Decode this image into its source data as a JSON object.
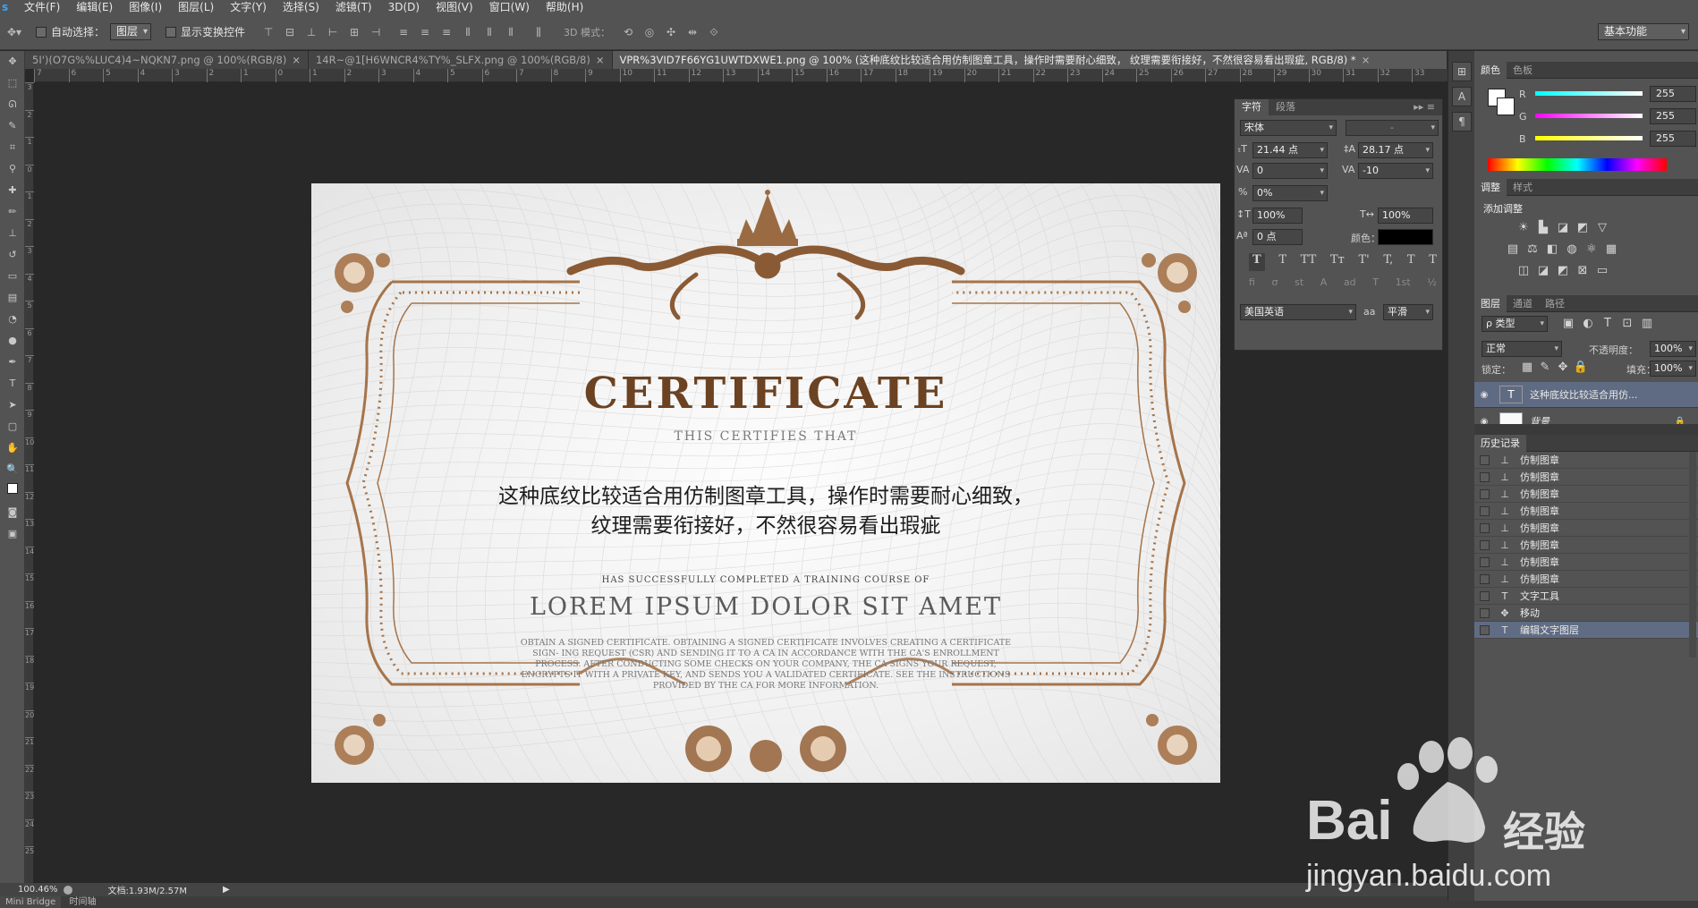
{
  "app": {
    "logo": "s"
  },
  "menu": [
    "文件(F)",
    "编辑(E)",
    "图像(I)",
    "图层(L)",
    "文字(Y)",
    "选择(S)",
    "滤镜(T)",
    "3D(D)",
    "视图(V)",
    "窗口(W)",
    "帮助(H)"
  ],
  "options": {
    "auto_select_label": "自动选择：",
    "auto_select_value": "图层",
    "show_transform_label": "显示变换控件",
    "mode3d_label": "3D 模式：",
    "workspace": "基本功能"
  },
  "tabs": [
    {
      "label": "5I')(O7G%%LUC4)4~NQKN7.png @ 100%(RGB/8)",
      "close": "×",
      "active": false
    },
    {
      "label": "14R~@1[H6WNCR4%TY%_SLFX.png @ 100%(RGB/8)",
      "close": "×",
      "active": false
    },
    {
      "label": "VPR%3VID7F66YG1UWTDXWE1.png @ 100% (这种底纹比较适合用仿制图章工具，操作时需要耐心细致，      纹理需要衔接好，不然很容易看出瑕疵, RGB/8) *",
      "close": "×",
      "active": true
    }
  ],
  "ruler_h": [
    "7",
    "6",
    "5",
    "4",
    "3",
    "2",
    "1",
    "0",
    "1",
    "2",
    "3",
    "4",
    "5",
    "6",
    "7",
    "8",
    "9",
    "10",
    "11",
    "12",
    "13",
    "14",
    "15",
    "16",
    "17",
    "18",
    "19",
    "20",
    "21",
    "22",
    "23",
    "24",
    "25",
    "26",
    "27",
    "28",
    "29",
    "30",
    "31",
    "32",
    "33"
  ],
  "ruler_v": [
    "3",
    "2",
    "1",
    "0",
    "1",
    "2",
    "3",
    "4",
    "5",
    "6",
    "7",
    "8",
    "9",
    "10",
    "11",
    "12",
    "13",
    "14",
    "15",
    "16",
    "17",
    "18",
    "19",
    "20",
    "21",
    "22",
    "23",
    "24",
    "25"
  ],
  "certificate": {
    "title": "CERTIFICATE",
    "subtitle": "THIS  CERTIFIES THAT",
    "cn_line1": "这种底纹比较适合用仿制图章工具，操作时需要耐心细致，",
    "cn_line2": "纹理需要衔接好，不然很容易看出瑕疵",
    "small": "HAS SUCCESSFULLY COMPLETED A TRAINING COURSE OF",
    "lorem": "LOREM IPSUM DOLOR SIT AMET",
    "body": "OBTAIN A SIGNED CERTIFICATE. OBTAINING A SIGNED CERTIFICATE INVOLVES CREATING A CERTIFICATE SIGN- ING REQUEST (CSR) AND SENDING IT TO A CA IN ACCORDANCE WITH THE CA'S ENROLLMENT PROCESS. AFTER CONDUCTING SOME CHECKS ON YOUR COMPANY, THE CA SIGNS YOUR REQUEST, ENCRYPTS IT WITH A PRIVATE KEY, AND SENDS YOU A VALIDATED CERTIFICATE. SEE THE INSTRUCTIONS PROVIDED BY THE CA FOR MORE INFORMATION."
  },
  "status": {
    "zoom": "100.46%",
    "doc": "文档:1.93M/2.57M",
    "play": "▶"
  },
  "bottom_tabs": [
    "Mini Bridge",
    "时间轴"
  ],
  "char_panel": {
    "tab_char": "字符",
    "tab_para": "段落",
    "font": "宋体",
    "style": "-",
    "size": "21.44 点",
    "leading": "28.17 点",
    "kerning": "0",
    "tracking": "-10",
    "scale_pct": "0%",
    "vscale": "100%",
    "hscale": "100%",
    "baseline": "0 点",
    "color_label": "颜色：",
    "styles": [
      "T",
      "T",
      "TT",
      "Tт",
      "T'",
      "T,",
      "T",
      "T"
    ],
    "opentype": [
      "fi",
      "σ",
      "st",
      "A",
      "ad",
      "T",
      "1st",
      "½"
    ],
    "language": "美国英语",
    "aa_icon": "aa",
    "aa": "平滑"
  },
  "color_panel": {
    "tab_color": "颜色",
    "tab_swatch": "色板",
    "r_label": "R",
    "g_label": "G",
    "b_label": "B",
    "r": "255",
    "g": "255",
    "b": "255"
  },
  "adjust_panel": {
    "tab_adjust": "调整",
    "tab_style": "样式",
    "add_label": "添加调整"
  },
  "layers_panel": {
    "tab_layers": "图层",
    "tab_channels": "通道",
    "tab_paths": "路径",
    "filter": "ρ 类型",
    "blend": "正常",
    "opacity_label": "不透明度：",
    "opacity": "100%",
    "lock_label": "锁定：",
    "fill_label": "填充：",
    "fill": "100%",
    "layers": [
      {
        "name": "这种底纹比较适合用仿...",
        "type": "T",
        "selected": true
      },
      {
        "name": "背景",
        "type": "img",
        "selected": false
      }
    ]
  },
  "history_panel": {
    "title": "历史记录",
    "items": [
      {
        "label": "仿制图章",
        "icon": "stamp-icon"
      },
      {
        "label": "仿制图章",
        "icon": "stamp-icon"
      },
      {
        "label": "仿制图章",
        "icon": "stamp-icon"
      },
      {
        "label": "仿制图章",
        "icon": "stamp-icon"
      },
      {
        "label": "仿制图章",
        "icon": "stamp-icon"
      },
      {
        "label": "仿制图章",
        "icon": "stamp-icon"
      },
      {
        "label": "仿制图章",
        "icon": "stamp-icon"
      },
      {
        "label": "仿制图章",
        "icon": "stamp-icon"
      },
      {
        "label": "文字工具",
        "icon": "type-icon"
      },
      {
        "label": "移动",
        "icon": "move-icon"
      },
      {
        "label": "编辑文字图层",
        "icon": "type-icon"
      }
    ]
  },
  "watermark": {
    "brand": "Bai",
    "cn": "经验",
    "url": "jingyan.baidu.com"
  },
  "colors": {
    "panel_bg": "#535353",
    "canvas_bg": "#282828",
    "gold": "#a6744a",
    "title": "#6b4222",
    "selection": "#5f6b82"
  }
}
